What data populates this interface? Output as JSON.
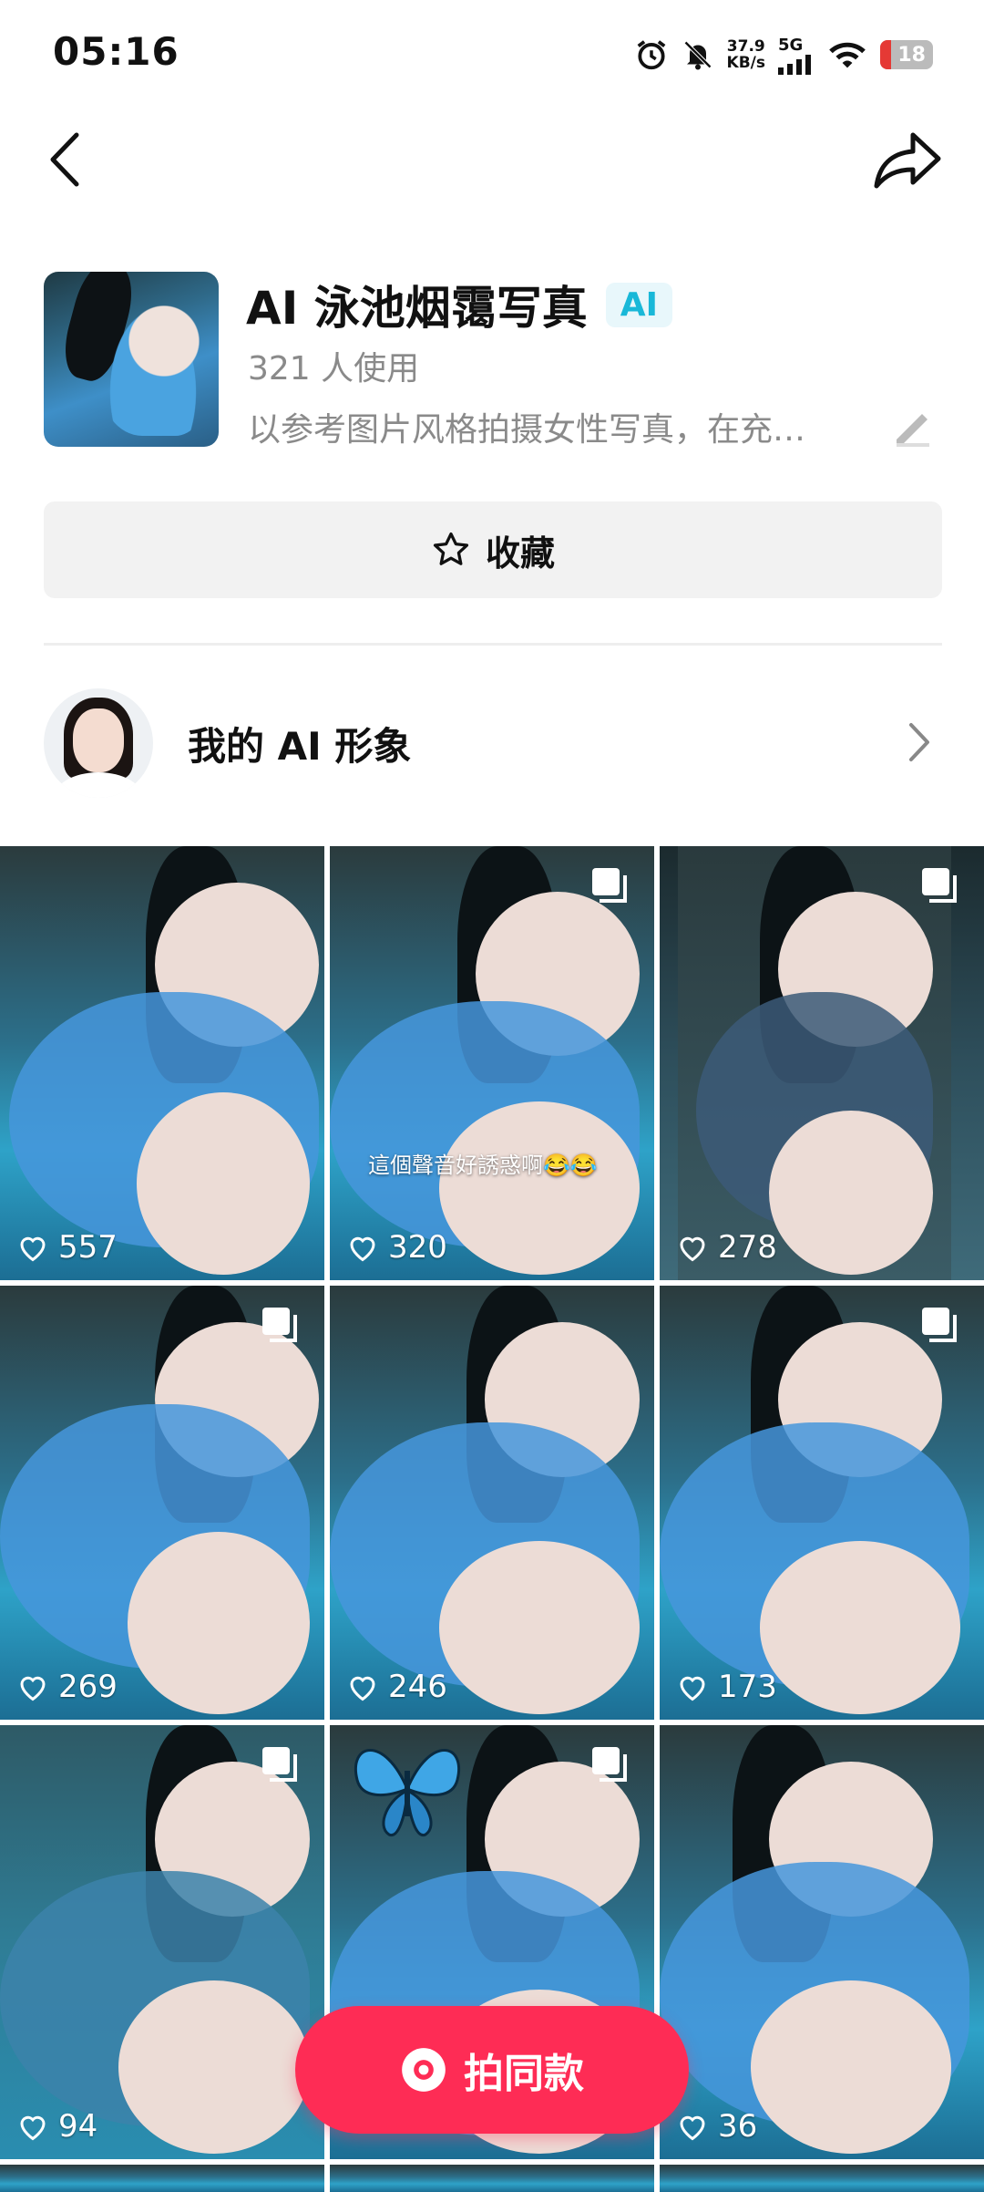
{
  "status": {
    "time": "05:16",
    "speed_top": "37.9",
    "speed_bottom": "KB/s",
    "network": "5G",
    "battery": "18"
  },
  "header": {
    "title": "AI 泳池烟霭写真",
    "badge": "AI",
    "users": "321 人使用",
    "description": "以参考图片风格拍摄女性写真，在充…"
  },
  "favorite": {
    "label": "收藏"
  },
  "profile": {
    "label": "我的 AI 形象"
  },
  "grid": [
    {
      "likes": "557",
      "multi": false,
      "caption": ""
    },
    {
      "likes": "320",
      "multi": true,
      "caption": "這個聲音好誘惑啊😂😂"
    },
    {
      "likes": "278",
      "multi": true,
      "caption": ""
    },
    {
      "likes": "269",
      "multi": true,
      "caption": ""
    },
    {
      "likes": "246",
      "multi": false,
      "caption": ""
    },
    {
      "likes": "173",
      "multi": true,
      "caption": ""
    },
    {
      "likes": "94",
      "multi": true,
      "caption": ""
    },
    {
      "likes": "",
      "multi": true,
      "caption": ""
    },
    {
      "likes": "36",
      "multi": false,
      "caption": ""
    }
  ],
  "cta": {
    "label": "拍同款"
  },
  "colors": {
    "accent": "#fe2c55",
    "ai_badge": "#19b8d8"
  }
}
